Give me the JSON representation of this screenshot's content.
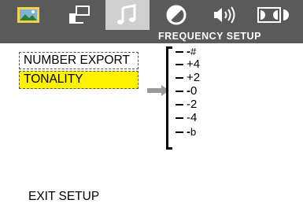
{
  "tabs": [
    {
      "icon": "picture-icon",
      "active": false
    },
    {
      "icon": "setup-icon",
      "active": false
    },
    {
      "icon": "music-note-icon",
      "active": true
    },
    {
      "icon": "contrast-icon",
      "active": false
    },
    {
      "icon": "speaker-icon",
      "active": false
    },
    {
      "icon": "dolby-icon",
      "active": false
    }
  ],
  "header": {
    "title": "FREQUENCY SETUP"
  },
  "menu": {
    "items": [
      {
        "label": "NUMBER EXPORT",
        "selected": false
      },
      {
        "label": "TONALITY",
        "selected": true
      }
    ]
  },
  "scale": {
    "values": [
      "#",
      "+4",
      "+2",
      "0",
      "-2",
      "-4",
      "b"
    ]
  },
  "exit": {
    "label": "EXIT SETUP"
  },
  "colors": {
    "bar": "#5a5a5a",
    "active_tab": "#cfcfcf",
    "highlight": "#fff200",
    "arrow": "#9a9a9a"
  }
}
